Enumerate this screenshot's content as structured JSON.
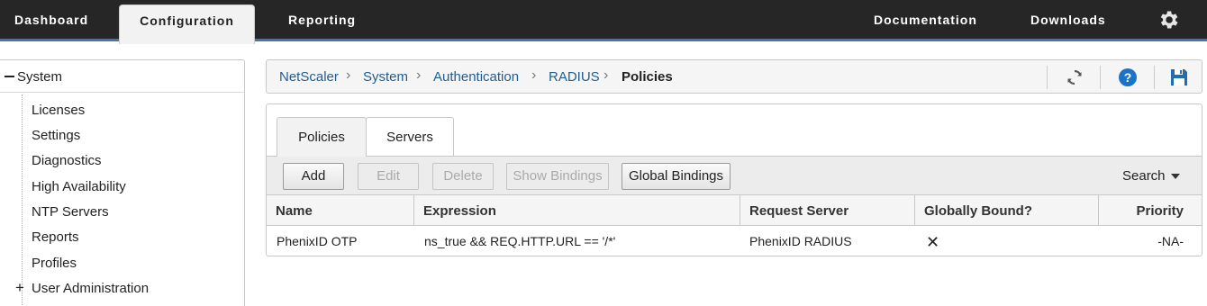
{
  "topnav": {
    "tabs": [
      {
        "label": "Dashboard",
        "active": false
      },
      {
        "label": "Configuration",
        "active": true
      },
      {
        "label": "Reporting",
        "active": false
      }
    ],
    "right_links": [
      "Documentation",
      "Downloads"
    ],
    "settings_icon": "gear-icon"
  },
  "sidebar": {
    "root_label": "System",
    "items": [
      "Licenses",
      "Settings",
      "Diagnostics",
      "High Availability",
      "NTP Servers",
      "Reports",
      "Profiles"
    ],
    "collapsed_item": "User Administration"
  },
  "breadcrumb": {
    "items": [
      "NetScaler",
      "System",
      "Authentication",
      "RADIUS"
    ],
    "current": "Policies",
    "icons": [
      "refresh-icon",
      "help-icon",
      "save-icon"
    ]
  },
  "panel": {
    "tabs": [
      {
        "label": "Policies",
        "active": true
      },
      {
        "label": "Servers",
        "active": false
      }
    ],
    "toolbar": {
      "add": "Add",
      "edit": "Edit",
      "delete": "Delete",
      "show_bindings": "Show Bindings",
      "global_bindings": "Global Bindings",
      "search": "Search"
    },
    "table": {
      "columns": [
        "Name",
        "Expression",
        "Request Server",
        "Globally Bound?",
        "Priority"
      ],
      "rows": [
        {
          "name": "PhenixID OTP",
          "expression": "ns_true && REQ.HTTP.URL == '/*'",
          "request_server": "PhenixID RADIUS",
          "globally_bound": "✕",
          "priority": "-NA-"
        }
      ]
    }
  },
  "colors": {
    "topbar": "#262626",
    "accent": "#4f6fb4",
    "link": "#1f5d94",
    "help": "#1a73c4",
    "save": "#1f6fb0"
  }
}
